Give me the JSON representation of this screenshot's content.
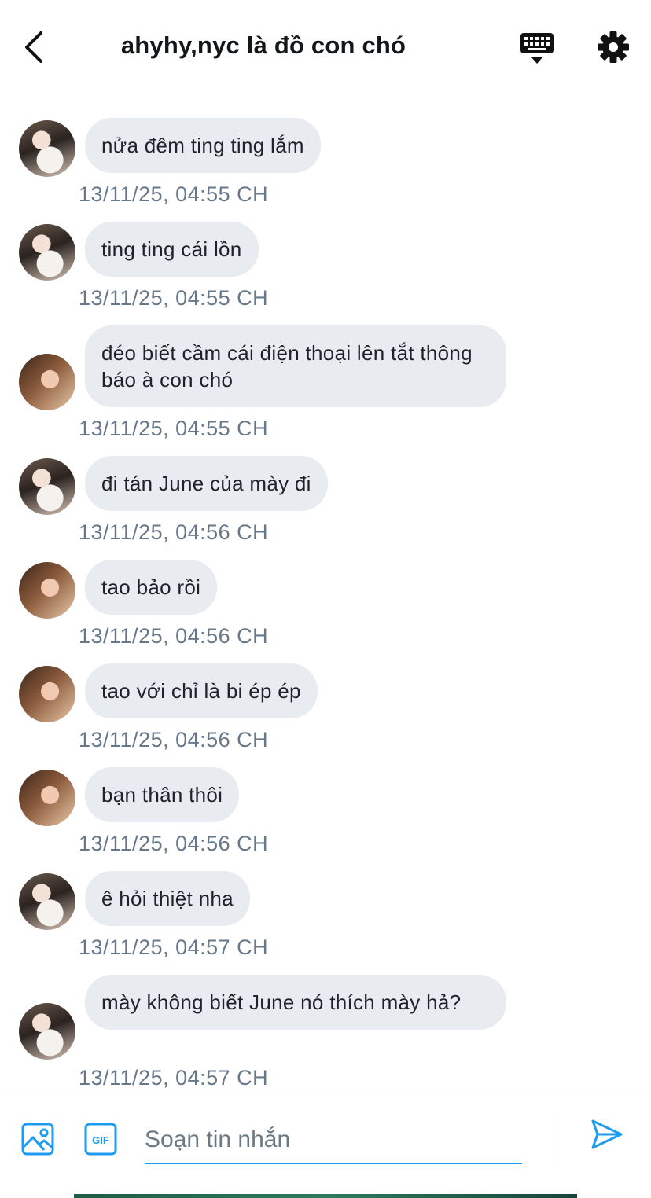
{
  "header": {
    "title": "ahyhy,nyc là đồ con chó",
    "back_icon": "chevron-left-icon",
    "keyboard_icon": "keyboard-icon",
    "settings_icon": "gear-icon"
  },
  "messages": [
    {
      "text": "nửa đêm ting ting lắm",
      "timestamp": "13/11/25, 04:55 CH",
      "avatar": "avatar-1"
    },
    {
      "text": "ting ting cái lồn",
      "timestamp": "13/11/25, 04:55 CH",
      "avatar": "avatar-1"
    },
    {
      "text": "đéo biết cầm cái điện thoại lên tắt thông báo à con chó",
      "timestamp": "13/11/25, 04:55 CH",
      "avatar": "avatar-2"
    },
    {
      "text": "đi tán June của mày đi",
      "timestamp": "13/11/25, 04:56 CH",
      "avatar": "avatar-1"
    },
    {
      "text": "tao bảo rồi",
      "timestamp": "13/11/25, 04:56 CH",
      "avatar": "avatar-2"
    },
    {
      "text": "tao với chỉ là bi ép ép",
      "timestamp": "13/11/25, 04:56 CH",
      "avatar": "avatar-2"
    },
    {
      "text": "bạn thân thôi",
      "timestamp": "13/11/25, 04:56 CH",
      "avatar": "avatar-2"
    },
    {
      "text": "ê hỏi thiệt nha",
      "timestamp": "13/11/25, 04:57 CH",
      "avatar": "avatar-1"
    },
    {
      "text": "mày không biết June nó thích mày hả?",
      "timestamp": "13/11/25, 04:57 CH",
      "avatar": "avatar-1"
    }
  ],
  "composer": {
    "placeholder": "Soạn tin nhắn",
    "value": "",
    "image_icon": "image-icon",
    "gif_icon": "gif-icon",
    "gif_label": "GIF",
    "send_icon": "send-icon"
  },
  "colors": {
    "accent": "#1d9bf0",
    "bubble": "#e8ecf0",
    "timestamp": "#67788a"
  }
}
